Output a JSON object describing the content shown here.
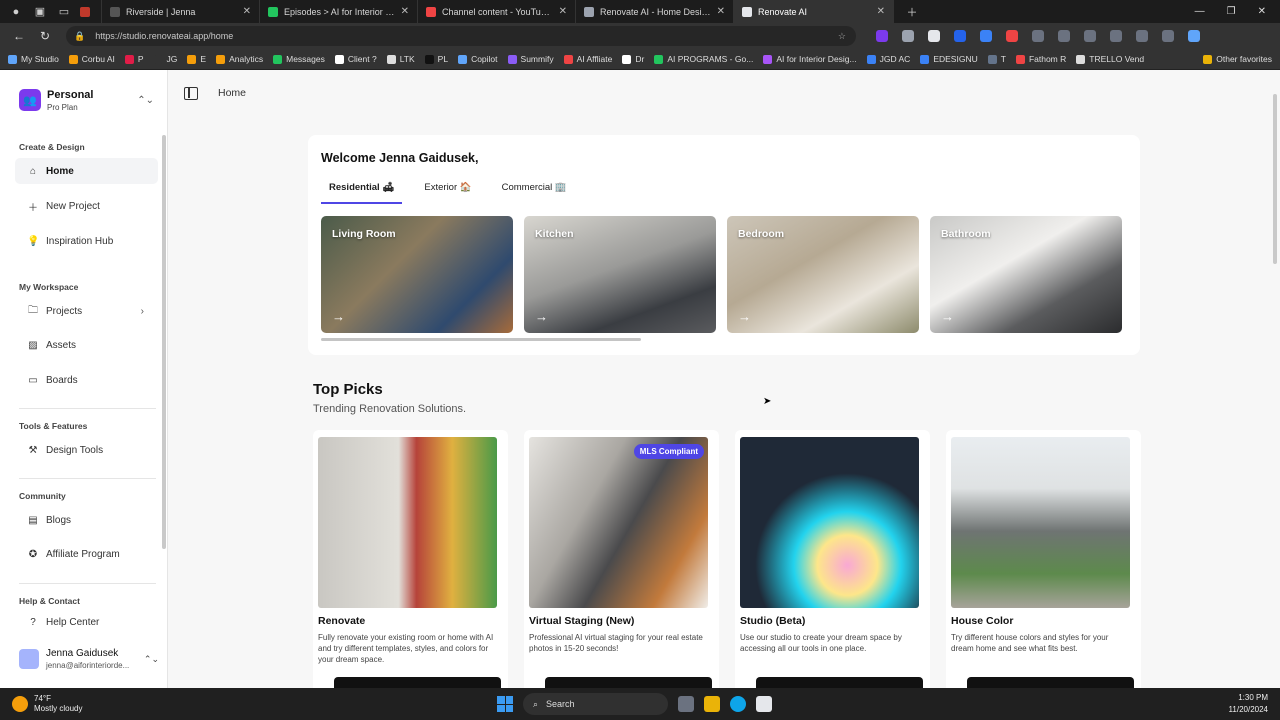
{
  "browser": {
    "tabs": [
      {
        "label": "",
        "color": "#c0392b"
      },
      {
        "label": "Riverside | Jenna",
        "color": "#555555"
      },
      {
        "label": "Episodes > AI for Interior Design",
        "color": "#22c55e"
      },
      {
        "label": "Channel content - YouTube Studio",
        "color": "#ef4444"
      },
      {
        "label": "Renovate AI - Home Design ideas",
        "color": "#9ca3af"
      },
      {
        "label": "Renovate AI",
        "color": "#e5e7eb"
      }
    ],
    "url": "https://studio.renovateai.app/home",
    "bookmarks": [
      "My Studio",
      "Corbu AI",
      "P",
      "JG",
      "E",
      "Analytics",
      "Messages",
      "Client ?",
      "LTK",
      "PL",
      "Copilot",
      "Summify",
      "AI Affliate",
      "Dr",
      "AI PROGRAMS - Go...",
      "AI for Interior Desig...",
      "JGD AC",
      "EDESIGNU",
      "T",
      "Fathom R",
      "TRELLO Vend"
    ],
    "other_favorites": "Other favorites"
  },
  "sidebar": {
    "workspace_name": "Personal",
    "workspace_plan": "Pro Plan",
    "sections": {
      "create": "Create & Design",
      "workspace": "My Workspace",
      "tools": "Tools & Features",
      "community": "Community",
      "help": "Help & Contact"
    },
    "items": {
      "home": "Home",
      "new_project": "New Project",
      "inspiration": "Inspiration Hub",
      "projects": "Projects",
      "assets": "Assets",
      "boards": "Boards",
      "design_tools": "Design Tools",
      "blogs": "Blogs",
      "affiliate": "Affiliate Program",
      "help_center": "Help Center"
    },
    "user": {
      "name": "Jenna Gaidusek",
      "email": "jenna@aiforinteriorde..."
    }
  },
  "header": {
    "breadcrumb": "Home"
  },
  "welcome": {
    "title": "Welcome Jenna Gaidusek,",
    "tabs": [
      "Residential 🛋",
      "Exterior 🏠",
      "Commercial 🏢"
    ],
    "rooms": [
      "Living Room",
      "Kitchen",
      "Bedroom",
      "Bathroom"
    ]
  },
  "top_picks": {
    "title": "Top Picks",
    "subtitle": "Trending Renovation Solutions.",
    "badge": "MLS Compliant",
    "cards": [
      {
        "title": "Renovate",
        "desc": "Fully renovate your existing room or home with AI and try different templates, styles, and colors for your dream space."
      },
      {
        "title": "Virtual Staging (New)",
        "desc": "Professional AI virtual staging for your real estate photos in 15-20 seconds!"
      },
      {
        "title": "Studio (Beta)",
        "desc": "Use our studio to create your dream space by accessing all our tools in one place."
      },
      {
        "title": "House Color",
        "desc": "Try different house colors and styles for your dream home and see what fits best."
      }
    ]
  },
  "taskbar": {
    "temp": "74°F",
    "weather": "Mostly cloudy",
    "search": "Search",
    "time": "1:30 PM",
    "date": "11/20/2024"
  }
}
